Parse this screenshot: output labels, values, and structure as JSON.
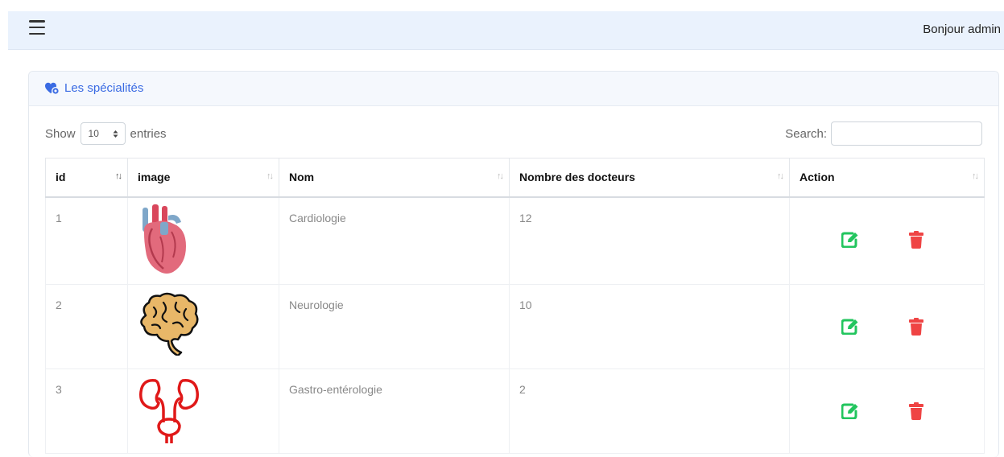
{
  "header": {
    "greeting": "Bonjour admin"
  },
  "card": {
    "title": "Les spécialités",
    "show_label": "Show",
    "entries_value": "10",
    "entries_label": "entries",
    "search_label": "Search:",
    "search_value": ""
  },
  "table": {
    "columns": [
      "id",
      "image",
      "Nom",
      "Nombre des docteurs",
      "Action"
    ],
    "rows": [
      {
        "id": "1",
        "image": "heart-icon",
        "nom": "Cardiologie",
        "docteurs": "12"
      },
      {
        "id": "2",
        "image": "brain-icon",
        "nom": "Neurologie",
        "docteurs": "10"
      },
      {
        "id": "3",
        "image": "kidneys-icon",
        "nom": "Gastro-entérologie",
        "docteurs": "2"
      }
    ]
  },
  "colors": {
    "accent": "#3a6be3",
    "edit": "#22c55e",
    "delete": "#ef4444",
    "topbar": "#eaf2fd"
  }
}
